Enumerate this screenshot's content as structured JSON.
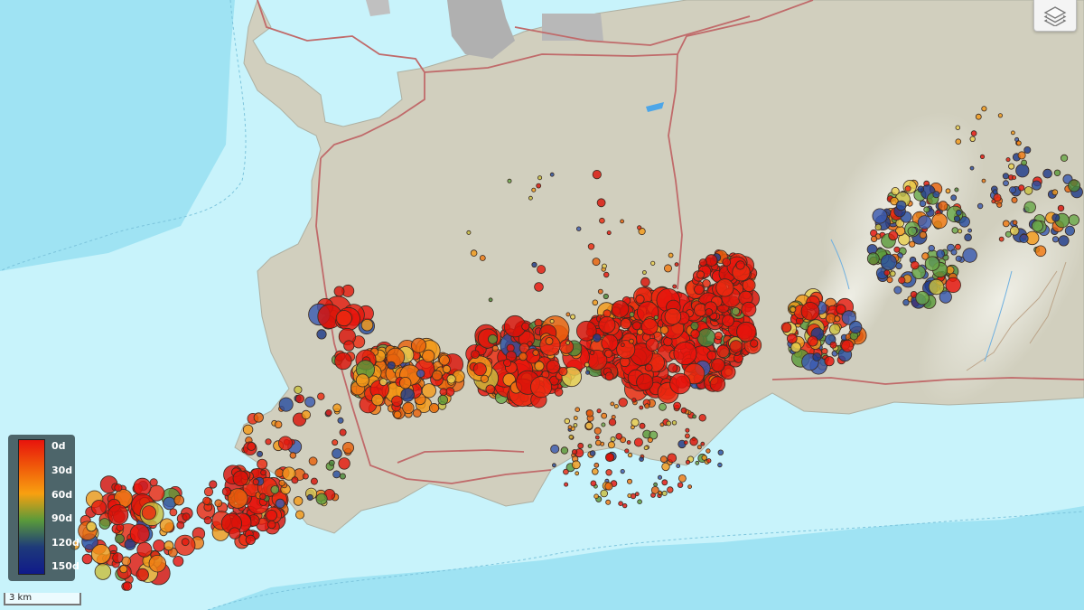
{
  "map": {
    "layer_control_icon": "layers-icon",
    "colors": {
      "ocean": "#9fe3f3",
      "shallow_water": "#c8f3fb",
      "land": "#d1cfbe",
      "road": "#c06a6a",
      "urban": "#b0b0b0"
    }
  },
  "legend": {
    "title": "",
    "labels": [
      "0d",
      "30d",
      "60d",
      "90d",
      "120d",
      "150d"
    ],
    "colors": [
      "#e8140c",
      "#f05a0a",
      "#f8a010",
      "#5a9a3a",
      "#1e3a7a",
      "#101a8a"
    ]
  },
  "scale": {
    "label": "3 km"
  }
}
